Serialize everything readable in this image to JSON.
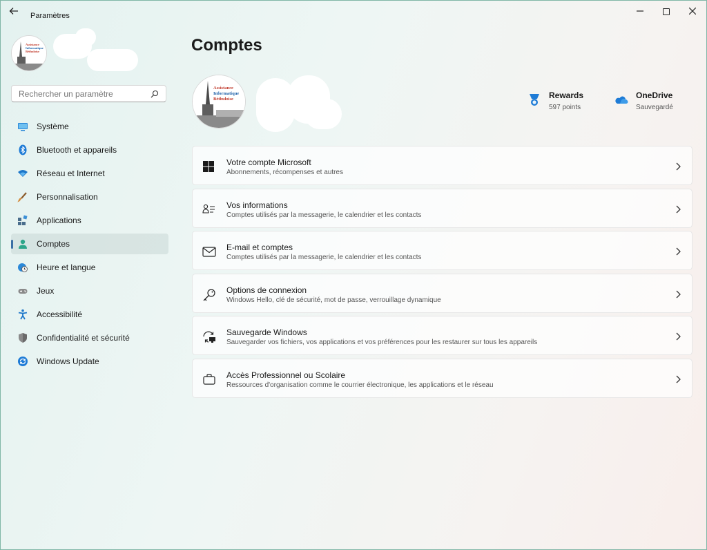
{
  "window": {
    "app_title": "Paramètres",
    "back_icon": "arrow-left-icon",
    "buttons": [
      "minimize-icon",
      "maximize-icon",
      "close-icon"
    ]
  },
  "search": {
    "placeholder": "Rechercher un paramètre",
    "icon": "search-icon"
  },
  "sidebar": {
    "items": [
      {
        "label": "Système",
        "icon": "monitor-icon",
        "color": "#2b88d8"
      },
      {
        "label": "Bluetooth et appareils",
        "icon": "bluetooth-icon",
        "color": "#1e7bd6"
      },
      {
        "label": "Réseau et Internet",
        "icon": "wifi-icon",
        "color": "#1b76c9"
      },
      {
        "label": "Personnalisation",
        "icon": "brush-icon",
        "color": "#d28a3a"
      },
      {
        "label": "Applications",
        "icon": "apps-icon",
        "color": "#4a6d8c"
      },
      {
        "label": "Comptes",
        "icon": "person-icon",
        "color": "#2ea58a",
        "active": true
      },
      {
        "label": "Heure et langue",
        "icon": "globe-clock-icon",
        "color": "#2b88d8"
      },
      {
        "label": "Jeux",
        "icon": "gamepad-icon",
        "color": "#777777"
      },
      {
        "label": "Accessibilité",
        "icon": "accessibility-icon",
        "color": "#1b76c9"
      },
      {
        "label": "Confidentialité et sécurité",
        "icon": "shield-icon",
        "color": "#7a7a7a"
      },
      {
        "label": "Windows Update",
        "icon": "update-icon",
        "color": "#1e7bd6"
      }
    ]
  },
  "main": {
    "title": "Comptes",
    "logo_lines": [
      "Assistance",
      "Informatique",
      "Béthuloise"
    ],
    "services": [
      {
        "name": "Rewards",
        "sub": "597 points",
        "icon": "rewards-medal-icon"
      },
      {
        "name": "OneDrive",
        "sub": "Sauvegardé",
        "icon": "onedrive-cloud-icon"
      }
    ],
    "cards": [
      {
        "title": "Votre compte Microsoft",
        "sub": "Abonnements, récompenses et autres",
        "icon": "windows-logo-icon"
      },
      {
        "title": "Vos informations",
        "sub": "Comptes utilisés par la messagerie, le calendrier et les contacts",
        "icon": "contact-card-icon"
      },
      {
        "title": "E-mail et comptes",
        "sub": "Comptes utilisés par la messagerie, le calendrier et les contacts",
        "icon": "mail-icon"
      },
      {
        "title": "Options de connexion",
        "sub": "Windows Hello, clé de sécurité, mot de passe, verrouillage dynamique",
        "icon": "key-icon"
      },
      {
        "title": "Sauvegarde Windows",
        "sub": "Sauvegarder vos fichiers, vos applications et vos préférences pour les restaurer sur tous les appareils",
        "icon": "backup-sync-icon"
      },
      {
        "title": "Accès Professionnel ou Scolaire",
        "sub": "Ressources d'organisation comme le courrier électronique, les applications et le réseau",
        "icon": "briefcase-icon"
      }
    ]
  }
}
